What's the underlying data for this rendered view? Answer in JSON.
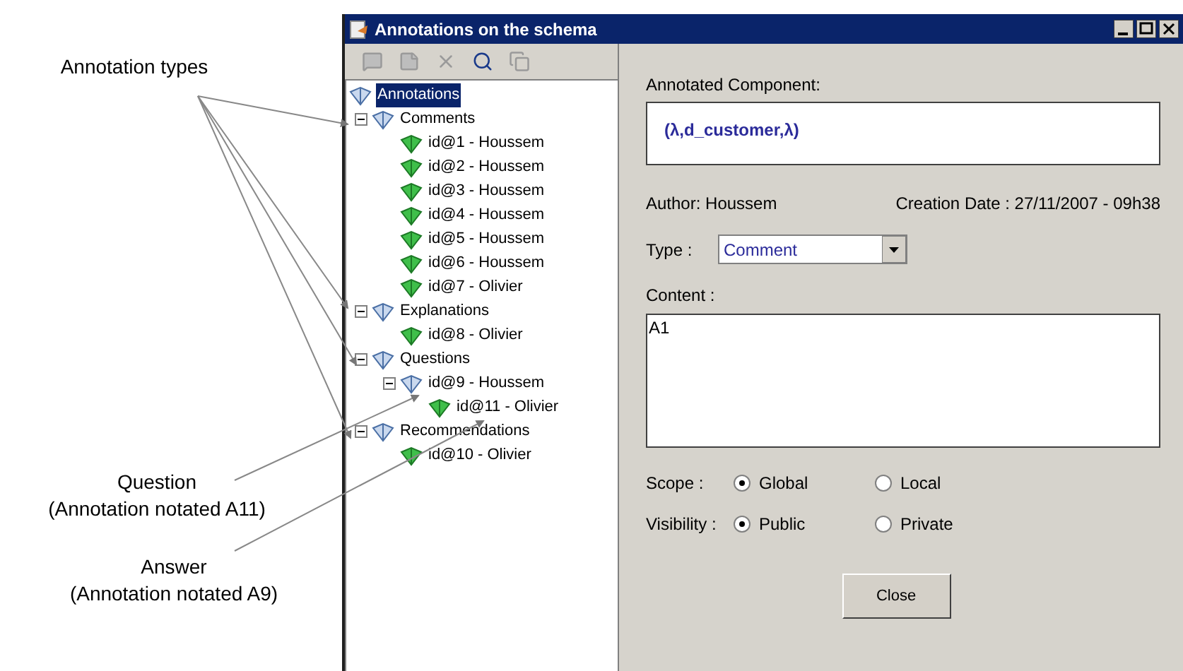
{
  "callouts": [
    {
      "lines": [
        "Annotation types"
      ]
    },
    {
      "lines": [
        "Question",
        "(Annotation notated A11)"
      ]
    },
    {
      "lines": [
        "Answer",
        "(Annotation notated A9)"
      ]
    }
  ],
  "window": {
    "title": "Annotations on the schema"
  },
  "toolbar": [
    {
      "kind": "comment",
      "disabled": true
    },
    {
      "kind": "note",
      "disabled": true
    },
    {
      "kind": "delete",
      "disabled": true
    },
    {
      "kind": "search",
      "disabled": false
    },
    {
      "kind": "copy",
      "disabled": true
    }
  ],
  "tree": {
    "label": "Annotations",
    "kind": "category",
    "selected": true,
    "children": [
      {
        "label": "Comments",
        "kind": "category",
        "selected": false,
        "expanded": true,
        "children": [
          {
            "label": "id@1 - Houssem",
            "kind": "note",
            "selected": false
          },
          {
            "label": "id@2 - Houssem",
            "kind": "note",
            "selected": false
          },
          {
            "label": "id@3 - Houssem",
            "kind": "note",
            "selected": false
          },
          {
            "label": "id@4 - Houssem",
            "kind": "note",
            "selected": false
          },
          {
            "label": "id@5 - Houssem",
            "kind": "note",
            "selected": false
          },
          {
            "label": "id@6 - Houssem",
            "kind": "note",
            "selected": false
          },
          {
            "label": "id@7 - Olivier",
            "kind": "note",
            "selected": false
          }
        ]
      },
      {
        "label": "Explanations",
        "kind": "category",
        "selected": false,
        "expanded": true,
        "children": [
          {
            "label": "id@8 - Olivier",
            "kind": "note",
            "selected": false
          }
        ]
      },
      {
        "label": "Questions",
        "kind": "category",
        "selected": false,
        "expanded": true,
        "children": [
          {
            "label": "id@9 - Houssem",
            "kind": "category",
            "selected": false,
            "expanded": true,
            "children": [
              {
                "label": "id@11 - Olivier",
                "kind": "note",
                "selected": false
              }
            ]
          }
        ]
      },
      {
        "label": "Recommendations",
        "kind": "category",
        "selected": false,
        "expanded": true,
        "children": [
          {
            "label": "id@10 - Olivier",
            "kind": "note",
            "selected": false
          }
        ]
      }
    ]
  },
  "form": {
    "component_label": "Annotated Component:",
    "component_value": "(λ,d_customer,λ)",
    "author": "Author: Houssem",
    "creation_date": "Creation Date : 27/11/2007 - 09h38",
    "type_label": "Type :",
    "type_value": "Comment",
    "content_label": "Content :",
    "content_value": "A1",
    "radio_groups": [
      {
        "label": "Scope :",
        "options": [
          {
            "label": "Global",
            "selected": true
          },
          {
            "label": "Local",
            "selected": false
          }
        ]
      },
      {
        "label": "Visibility :",
        "options": [
          {
            "label": "Public",
            "selected": true
          },
          {
            "label": "Private",
            "selected": false
          }
        ]
      }
    ],
    "close_button": "Close"
  }
}
